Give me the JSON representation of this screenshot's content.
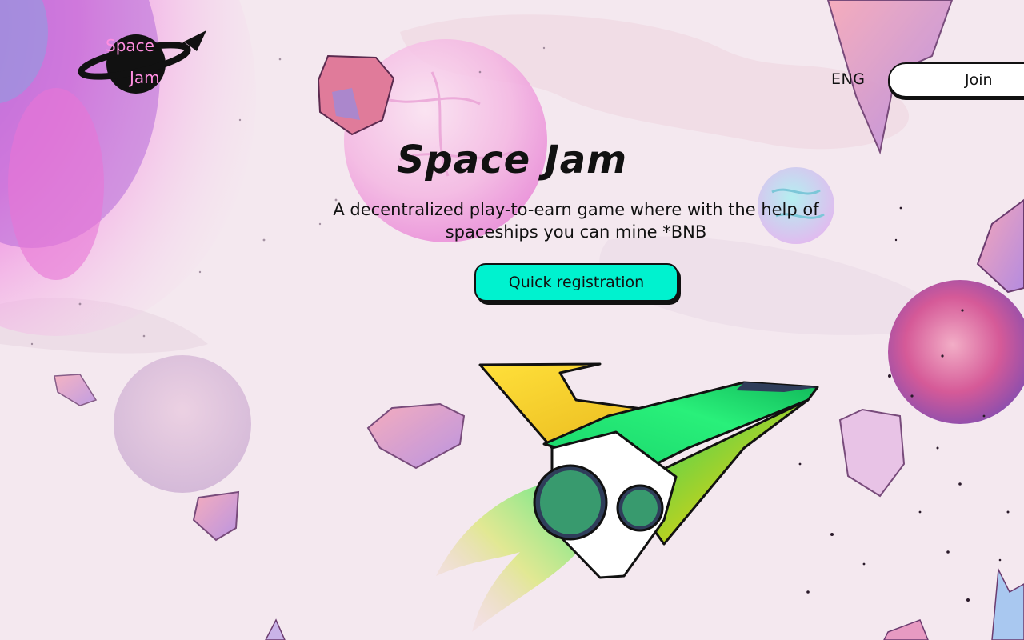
{
  "header": {
    "logo": {
      "line1": "Space",
      "line2": "Jam"
    },
    "language": "ENG",
    "join_label": "Join"
  },
  "hero": {
    "title": "Space Jam",
    "subtitle": "A decentralized play-to-earn game where with the help of spaceships you can mine *BNB",
    "cta_label": "Quick registration"
  },
  "colors": {
    "cta": "#00f2cf",
    "text": "#111111",
    "background": "#f3e6ee",
    "accent_pink": "#ff8ee0"
  },
  "icons": {
    "logo_rocket": "rocket-icon"
  }
}
